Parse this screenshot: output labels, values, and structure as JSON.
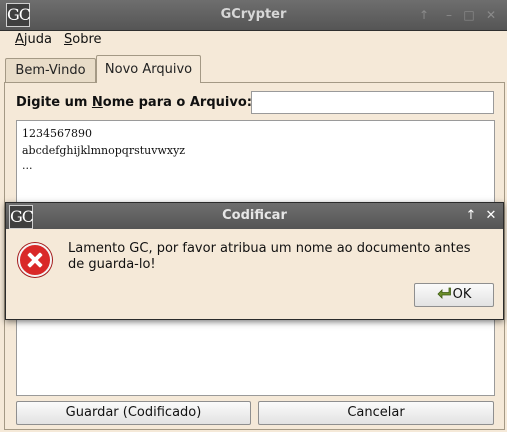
{
  "window": {
    "title": "GCrypter",
    "logo_text": "GC"
  },
  "menu": {
    "items": [
      {
        "label_prefix": "",
        "mnemonic": "A",
        "label_rest": "juda"
      },
      {
        "label_prefix": "",
        "mnemonic": "S",
        "label_rest": "obre"
      }
    ]
  },
  "tabs": [
    {
      "label": "Bem-Vindo",
      "active": false
    },
    {
      "label": "Novo Arquivo",
      "active": true
    }
  ],
  "form": {
    "name_label_prefix": "Digite um ",
    "name_label_mnemonic": "N",
    "name_label_rest": "ome para o Arquivo: *",
    "name_value": ""
  },
  "editor": {
    "lines": [
      "1234567890",
      "abcdefghijklmnopqrstuvwxyz",
      "..."
    ]
  },
  "buttons": {
    "save": "Guardar (Codificado)",
    "cancel": "Cancelar"
  },
  "dialog": {
    "title": "Codificar",
    "logo_text": "GC",
    "message": "Lamento GC, por favor atribua um nome ao documento antes de guarda-lo!",
    "ok_label": "OK"
  },
  "colors": {
    "window_bg": "#f5e9d8",
    "titlebar": "#5f5f5f",
    "error_red": "#d92828"
  }
}
